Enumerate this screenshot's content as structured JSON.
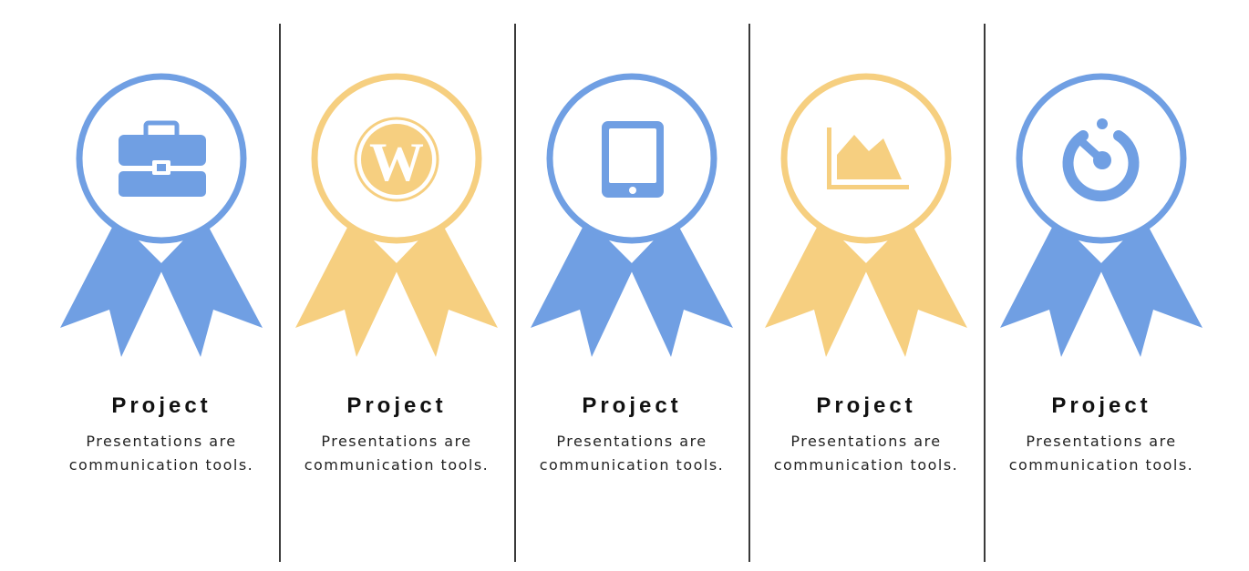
{
  "colors": {
    "blue": "#709fe3",
    "yellow": "#f6cf80",
    "divider": "#3a3a3a",
    "text": "#111111"
  },
  "awards": [
    {
      "color": "blue",
      "icon": "briefcase-icon",
      "title": "Project",
      "desc_line1": "Presentations are",
      "desc_line2": "communication tools."
    },
    {
      "color": "yellow",
      "icon": "wordpress-icon",
      "title": "Project",
      "desc_line1": "Presentations are",
      "desc_line2": "communication tools."
    },
    {
      "color": "blue",
      "icon": "tablet-icon",
      "title": "Project",
      "desc_line1": "Presentations are",
      "desc_line2": "communication tools."
    },
    {
      "color": "yellow",
      "icon": "area-chart-icon",
      "title": "Project",
      "desc_line1": "Presentations are",
      "desc_line2": "communication tools."
    },
    {
      "color": "blue",
      "icon": "power-icon",
      "title": "Project",
      "desc_line1": "Presentations are",
      "desc_line2": "communication tools."
    }
  ]
}
